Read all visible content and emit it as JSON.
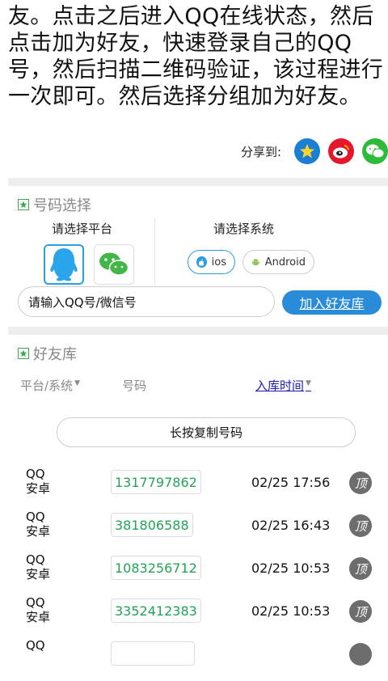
{
  "intro": {
    "lines": [
      "友。点击之后进入QQ在线状态，然后",
      "点击加为好友，快速登录自己的QQ",
      "号，然后扫描二维码验证，该过程进行",
      "一次即可。然后选择分组加为好友。"
    ]
  },
  "share": {
    "label": "分享到:",
    "icons": [
      "qzone-icon",
      "weibo-icon",
      "wechat-icon"
    ]
  },
  "number_select": {
    "title": "号码选择",
    "platform_label": "请选择平台",
    "platforms": [
      "qq-penguin-icon",
      "wechat-icon"
    ],
    "system_label": "请选择系统",
    "systems": [
      "ios",
      "Android"
    ],
    "input_placeholder": "请输入QQ号/微信号",
    "add_button": "加入好友库"
  },
  "friend_lib": {
    "title": "好友库",
    "columns": [
      "平台/系统",
      "号码",
      "入库时间"
    ],
    "copy_button": "长按复制号码",
    "top_label": "顶",
    "rows": [
      {
        "platform": "QQ",
        "system": "安卓",
        "number": "1317797862",
        "time": "02/25 17:56"
      },
      {
        "platform": "QQ",
        "system": "安卓",
        "number": "381806588",
        "time": "02/25 16:43"
      },
      {
        "platform": "QQ",
        "system": "安卓",
        "number": "1083256712",
        "time": "02/25 10:53"
      },
      {
        "platform": "QQ",
        "system": "安卓",
        "number": "3352412383",
        "time": "02/25 10:53"
      },
      {
        "platform": "QQ",
        "system": "",
        "number": "",
        "time": ""
      }
    ]
  },
  "colors": {
    "accent_blue": "#2a8cd8",
    "number_green": "#22a355",
    "link_blue": "#1a1ab4"
  }
}
